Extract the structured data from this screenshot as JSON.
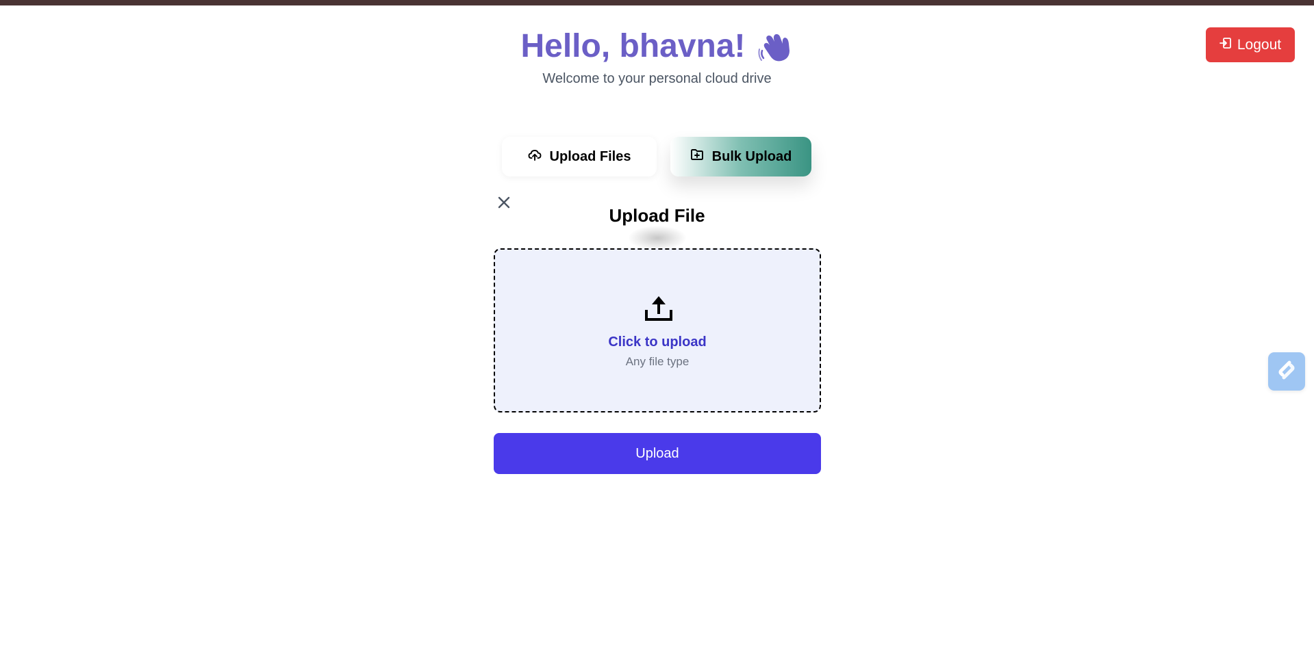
{
  "header": {
    "greeting": "Hello, bhavna!",
    "subtitle": "Welcome to your personal cloud drive",
    "logout_label": "Logout"
  },
  "tabs": [
    {
      "label": "Upload Files",
      "icon": "cloud-upload-icon"
    },
    {
      "label": "Bulk Upload",
      "icon": "folder-plus-icon"
    }
  ],
  "upload_panel": {
    "title": "Upload File",
    "dropzone_main": "Click to upload",
    "dropzone_sub": "Any file type",
    "submit_label": "Upload"
  },
  "colors": {
    "greeting": "#6b5fc6",
    "logout": "#e53e3e",
    "upload_button": "#4a3aea",
    "dropzone_bg": "#eef1fc",
    "bulk_tab_accent": "#3a9483"
  }
}
